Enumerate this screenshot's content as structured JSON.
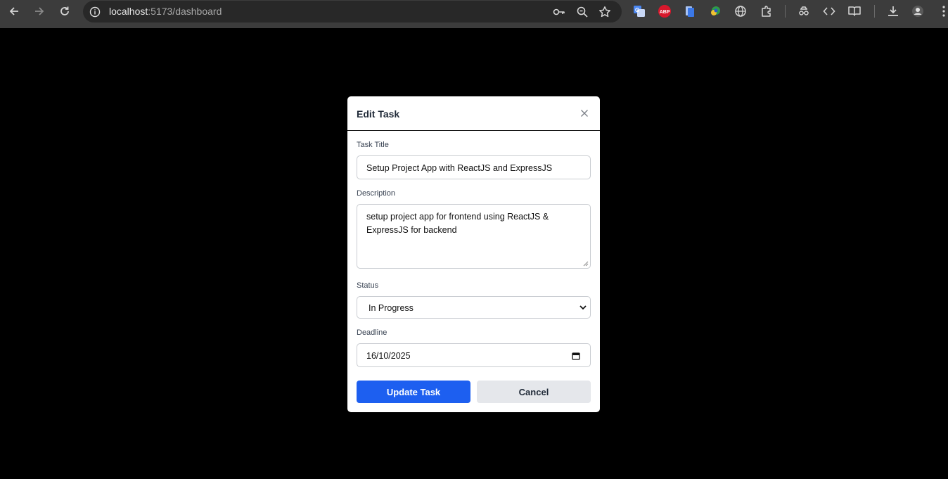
{
  "browser": {
    "url_host": "localhost",
    "url_path": ":5173/dashboard",
    "extensions": [
      "google-translate-icon",
      "adblock-plus-icon",
      "document-extension-icon",
      "color-extension-icon",
      "globe-icon",
      "extensions-puzzle-icon",
      "lab-flask-icon",
      "devtools-code-icon",
      "reading-list-icon",
      "download-icon",
      "profile-icon",
      "menu-icon"
    ],
    "adblock_badge": "ABP"
  },
  "modal": {
    "title": "Edit Task",
    "task_title_label": "Task Title",
    "task_title_value": "Setup Project App with ReactJS and ExpressJS",
    "description_label": "Description",
    "description_value": "setup project app for frontend using ReactJS & ExpressJS for backend",
    "status_label": "Status",
    "status_value": "In Progress",
    "deadline_label": "Deadline",
    "deadline_value": "16/10/2025",
    "update_button": "Update Task",
    "cancel_button": "Cancel"
  },
  "colors": {
    "primary": "#1d5ff0",
    "secondary": "#e5e7eb",
    "chrome": "#3c3c3c",
    "omnibox": "#282828"
  }
}
